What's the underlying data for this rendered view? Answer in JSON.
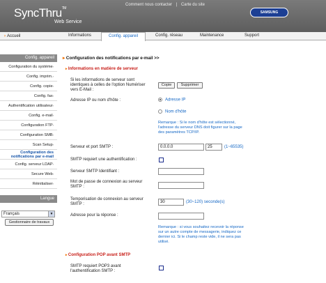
{
  "header": {
    "logo": "SyncThru",
    "logo_tm": "TM",
    "logo_sub": "Web Service",
    "links": [
      "Comment nous contacter",
      "|",
      "Carte du site"
    ],
    "brand": "SAMSUNG"
  },
  "nav": {
    "home": "Accueil",
    "tabs": [
      "Informations",
      "Config. appareil",
      "Config. réseau",
      "Maintenance",
      "Support"
    ]
  },
  "sidebar": {
    "head": "Config. appareil",
    "items": [
      "Configuration du système",
      "Config. imprim.",
      "Config. copie",
      "Config. fax",
      "Authentification utilisateur",
      "Config. e-mail",
      "Configuration FTP",
      "Configuration SMB",
      "Scan Setup",
      "Configuration des notifications par e-mail",
      "Config. serveur LDAP",
      "Secure Web",
      "Réinitialiser"
    ],
    "lang_head": "Langue",
    "lang_value": "Français",
    "task_button": "Gestionnaire de travaux"
  },
  "main": {
    "title": "Configuration des notifications par e-mail >>",
    "section1": "Informations en matière de serveur",
    "info_text": "Si les informations de serveur sont identiques à celles de l'option Numériser vers E-Mail :",
    "copy_btn": "Copie",
    "delete_btn": "Supprimer",
    "ip_label": "Adresse IP ou nom d'hôte :",
    "radio_ip": "Adresse IP",
    "radio_host": "Nom d'hôte",
    "dns_note": "Remarque : Si le nom d'hôte est sélectionné, l'adresse du serveur DNS doit figurer sur la page des paramètres TCP/IP.",
    "smtp_label": "Serveur et port SMTP :",
    "smtp_ip": "0.0.0.0",
    "smtp_port": "25",
    "port_range": "(1~65535)",
    "auth_label": "SMTP requiert une authentification :",
    "smtp_id_label": "Serveur SMTP Identifiant :",
    "smtp_pw_label": "Mot de passe de connexion au serveur SMTP :",
    "timeout_label": "Temporisation de connexion au serveur SMTP :",
    "timeout_value": "30",
    "timeout_range": "(30~120) seconde(s)",
    "reply_label": "Adresse pour la réponse :",
    "reply_note": "Remarque : si vous souhaitez recevoir la réponse sur un autre compte de messagerie, indiquez ce dernier ici. Si le champ reste vide, il ne sera pas utilisé.",
    "section2": "Configuration POP avant SMTP",
    "pop_label": "SMTP requiert POP3 avant l'authentification SMTP :"
  },
  "colors": {
    "accent": "#f07000",
    "link": "#1467c5",
    "section": "#c8201a"
  }
}
